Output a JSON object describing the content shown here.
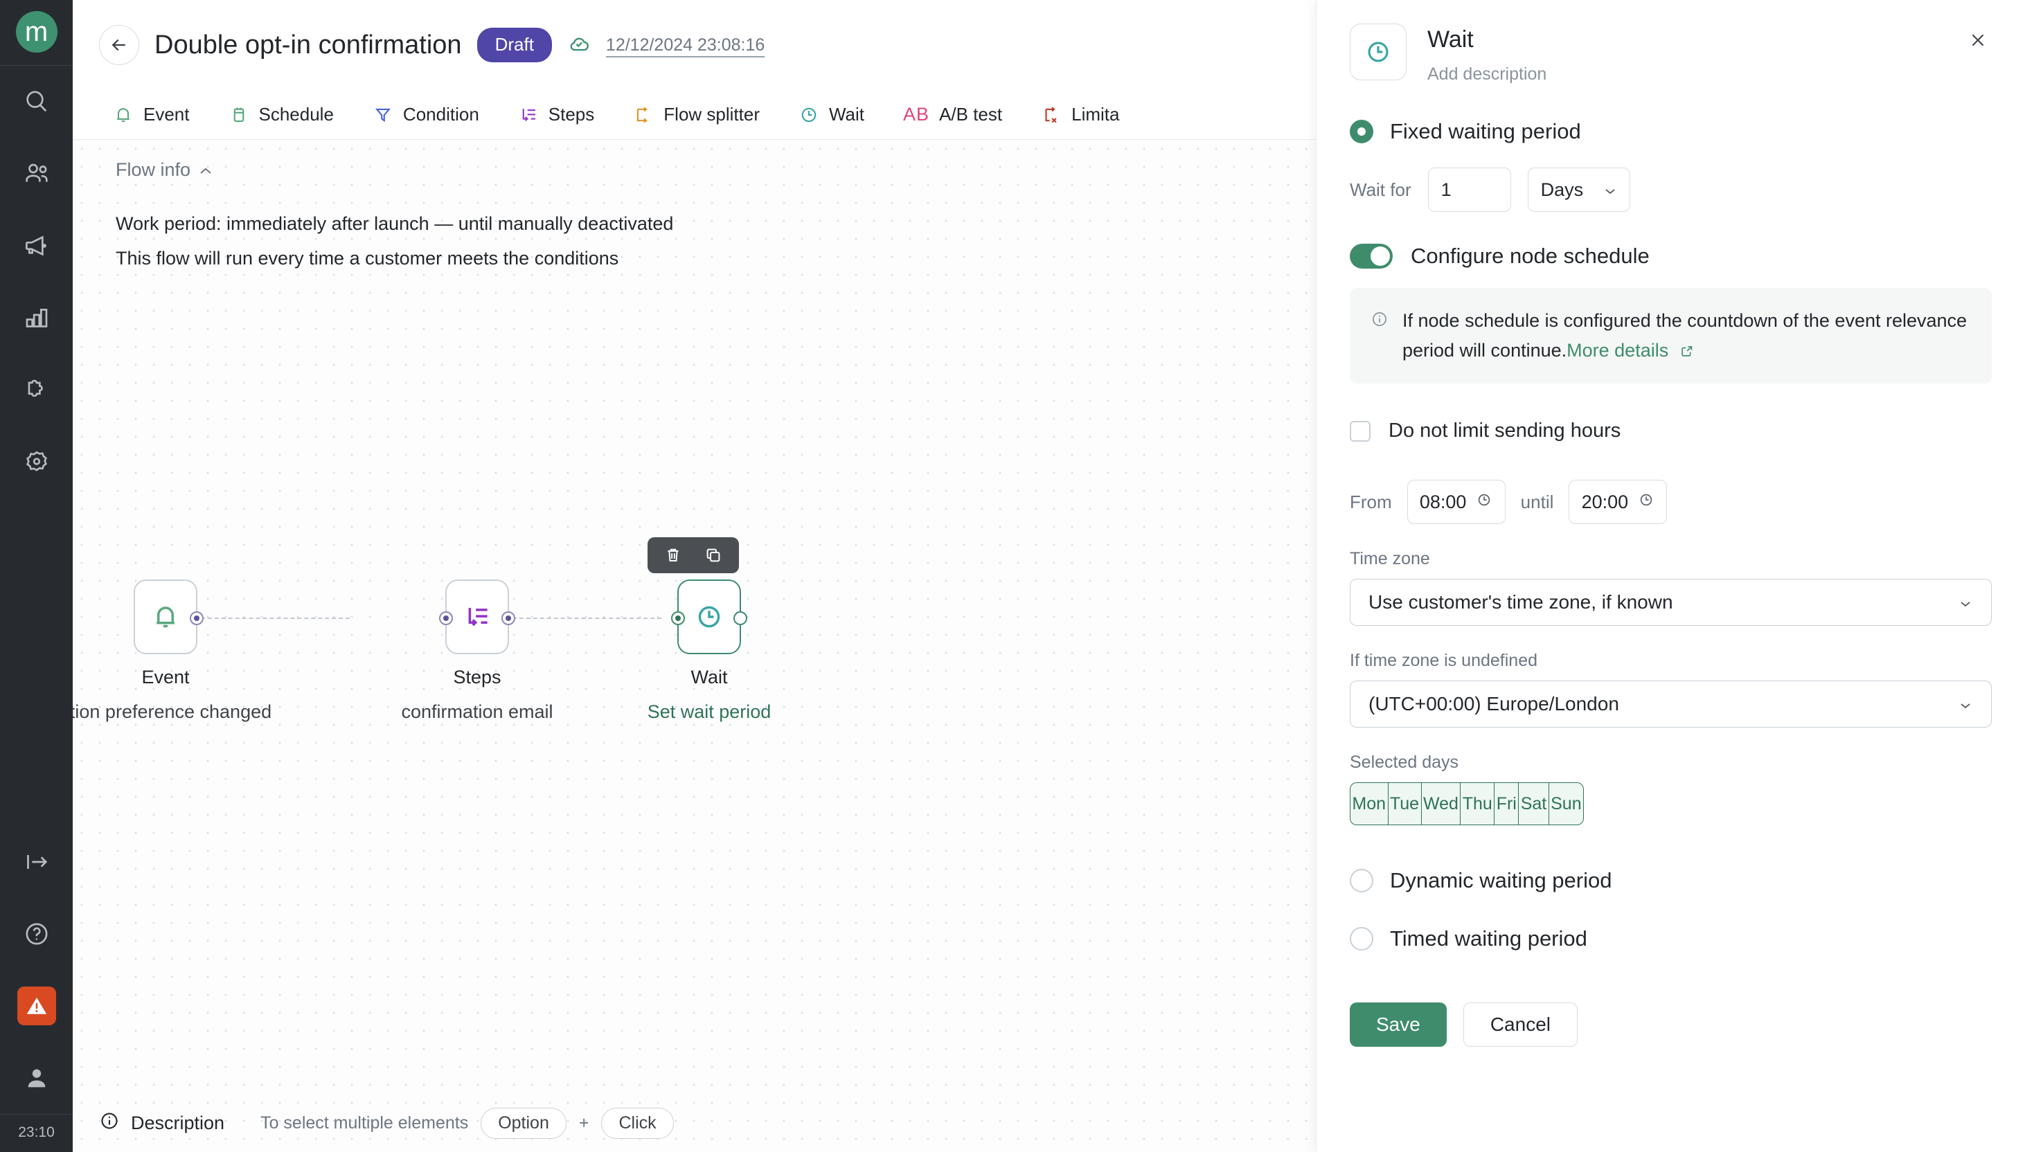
{
  "rail": {
    "logo": "m",
    "items": [
      {
        "name": "search-icon",
        "label": "Search"
      },
      {
        "name": "audience-icon",
        "label": "Audience"
      },
      {
        "name": "campaigns-icon",
        "label": "Campaigns"
      },
      {
        "name": "analytics-icon",
        "label": "Analytics"
      },
      {
        "name": "integrations-icon",
        "label": "Integrations"
      },
      {
        "name": "settings-icon",
        "label": "Settings"
      }
    ],
    "bottom_items": [
      {
        "name": "collapse-icon",
        "label": "Collapse"
      },
      {
        "name": "help-icon",
        "label": "Help"
      },
      {
        "name": "alert-icon",
        "label": "Alerts"
      },
      {
        "name": "user-avatar-icon",
        "label": "Account"
      }
    ],
    "clock": "23:10",
    "alert_color": "#d94a23",
    "logo_color": "#3f9271"
  },
  "topbar": {
    "back_label": "Back",
    "title": "Double opt-in confirmation",
    "status_badge": "Draft",
    "status_badge_color": "#4f46a8",
    "saved_at": "12/12/2024 23:08:16",
    "cloud_icon": "cloud-check-icon"
  },
  "nodebar": {
    "tabs": [
      {
        "label": "Event",
        "icon": "bell-icon",
        "color": "#5aa87f"
      },
      {
        "label": "Schedule",
        "icon": "calendar-icon",
        "color": "#5aa87f"
      },
      {
        "label": "Condition",
        "icon": "funnel-icon",
        "color": "#4a63d8"
      },
      {
        "label": "Steps",
        "icon": "steps-icon",
        "color": "#9333c5"
      },
      {
        "label": "Flow splitter",
        "icon": "flow-splitter-icon",
        "color": "#e09429"
      },
      {
        "label": "Wait",
        "icon": "clock-icon",
        "color": "#3aa5a5"
      },
      {
        "label": "A/B test",
        "icon": "ab-test-icon",
        "color": "#e0457b"
      },
      {
        "label": "Limita",
        "icon": "limitation-icon",
        "color": "#c23b22"
      }
    ]
  },
  "canvas": {
    "flow_info": {
      "title": "Flow info",
      "toggle_icon": "chevron-up-icon",
      "lines": [
        "Work period: immediately after launch — until manually deactivated",
        "This flow will run every time a customer meets the conditions"
      ]
    },
    "nodes": [
      {
        "label": "Event",
        "sublabel": "ption preference changed",
        "icon": "bell-icon",
        "selected": false,
        "sub_green": false
      },
      {
        "label": "Steps",
        "sublabel": "confirmation email",
        "icon": "steps-icon",
        "selected": false,
        "sub_green": false
      },
      {
        "label": "Wait",
        "sublabel": "Set wait period",
        "icon": "clock-icon",
        "selected": true,
        "sub_green": true
      }
    ],
    "node_toolbar": [
      {
        "name": "delete-node-button",
        "icon": "trash-icon"
      },
      {
        "name": "duplicate-node-button",
        "icon": "copy-icon"
      }
    ]
  },
  "bottombar": {
    "description_label": "Description",
    "description_icon": "info-icon",
    "hint_text": "To select multiple elements",
    "key_modifier": "Option",
    "key_plus": "+",
    "key_action": "Click"
  },
  "panel": {
    "icon": "clock-icon",
    "title": "Wait",
    "description_placeholder": "Add description",
    "close_icon": "close-icon",
    "options": [
      {
        "label": "Fixed waiting period",
        "checked": true
      },
      {
        "label": "Dynamic waiting period",
        "checked": false
      },
      {
        "label": "Timed waiting period",
        "checked": false
      }
    ],
    "wait_for": {
      "label": "Wait for",
      "value": "1",
      "unit": "Days",
      "unit_chevron": "chevron-down-icon"
    },
    "node_schedule": {
      "label": "Configure node schedule",
      "enabled": true,
      "toggle_color": "#3f8c6c"
    },
    "info": {
      "icon": "info-circle-icon",
      "text": "If node schedule is configured the countdown of the event relevance period will continue.",
      "link_text": "More details",
      "link_icon": "external-link-icon"
    },
    "no_limit_hours": {
      "label": "Do not limit sending hours",
      "checked": false
    },
    "hours": {
      "from_label": "From",
      "from_value": "08:00",
      "until_label": "until",
      "until_value": "20:00",
      "clock_icon": "clock-icon"
    },
    "timezone": {
      "label": "Time zone",
      "value": "Use customer's time zone, if known",
      "chevron": "chevron-down-icon"
    },
    "fallback_timezone": {
      "label": "If time zone is undefined",
      "value": "(UTC+00:00) Europe/London",
      "chevron": "chevron-down-icon"
    },
    "selected_days": {
      "label": "Selected days",
      "days": [
        {
          "label": "Mon",
          "selected": true
        },
        {
          "label": "Tue",
          "selected": true
        },
        {
          "label": "Wed",
          "selected": true
        },
        {
          "label": "Thu",
          "selected": true
        },
        {
          "label": "Fri",
          "selected": true
        },
        {
          "label": "Sat",
          "selected": true
        },
        {
          "label": "Sun",
          "selected": true
        }
      ]
    },
    "actions": {
      "save_label": "Save",
      "cancel_label": "Cancel",
      "save_color": "#3f8c6c"
    }
  }
}
